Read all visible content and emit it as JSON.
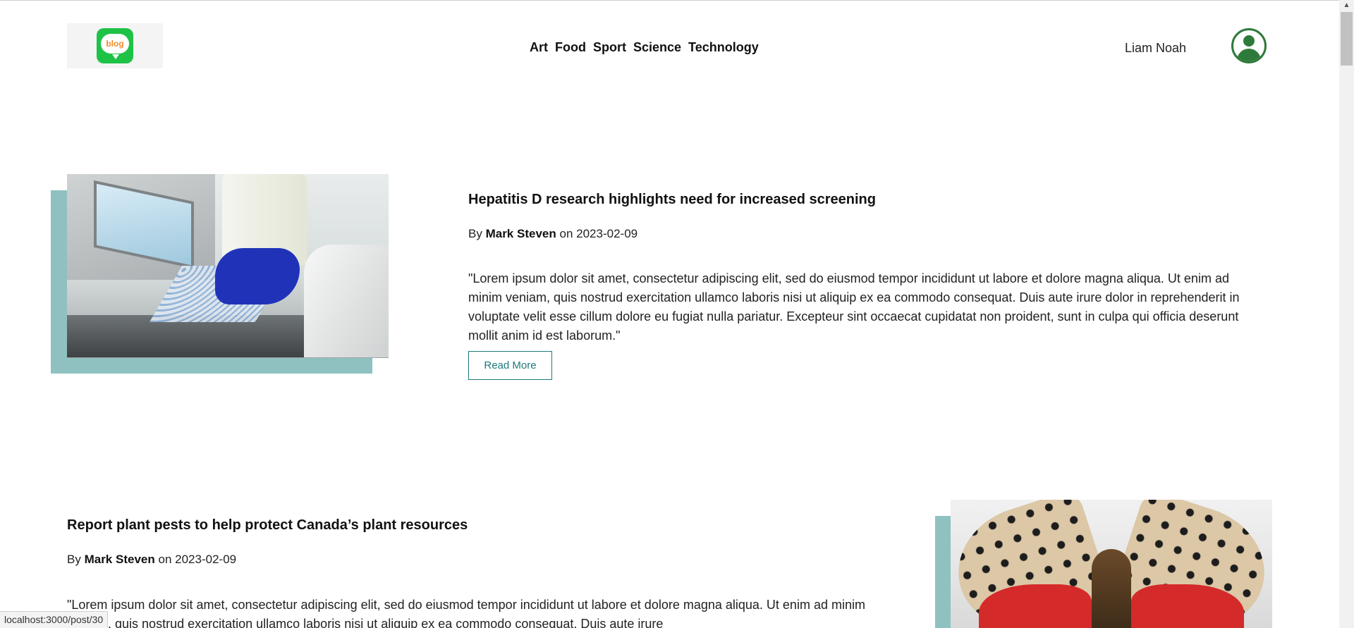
{
  "header": {
    "logo_text": "blog",
    "nav": [
      "Art",
      "Food",
      "Sport",
      "Science",
      "Technology"
    ],
    "username": "Liam Noah"
  },
  "posts": [
    {
      "title": "Hepatitis D research highlights need for increased screening",
      "by_prefix": "By",
      "author": "Mark Steven",
      "on_word": "on",
      "date": "2023-02-09",
      "excerpt": "\"Lorem ipsum dolor sit amet, consectetur adipiscing elit, sed do eiusmod tempor incididunt ut labore et dolore magna aliqua. Ut enim ad minim veniam, quis nostrud exercitation ullamco laboris nisi ut aliquip ex ea commodo consequat. Duis aute irure dolor in reprehenderit in voluptate velit esse cillum dolore eu fugiat nulla pariatur. Excepteur sint occaecat cupidatat non proident, sunt in culpa qui officia deserunt mollit anim id est laborum.\"",
      "read_more": "Read More"
    },
    {
      "title": "Report plant pests to help protect Canada’s plant resources",
      "by_prefix": "By",
      "author": "Mark Steven",
      "on_word": "on",
      "date": "2023-02-09",
      "excerpt": "\"Lorem ipsum dolor sit amet, consectetur adipiscing elit, sed do eiusmod tempor incididunt ut labore et dolore magna aliqua. Ut enim ad minim veniam, quis nostrud exercitation ullamco laboris nisi ut aliquip ex ea commodo consequat. Duis aute irure"
    }
  ],
  "status_url": "localhost:3000/post/30",
  "colors": {
    "accent_teal": "#8fc1c1",
    "button_teal": "#1f7a7a",
    "logo_green": "#1ec247",
    "avatar_green": "#2e7a3a"
  }
}
